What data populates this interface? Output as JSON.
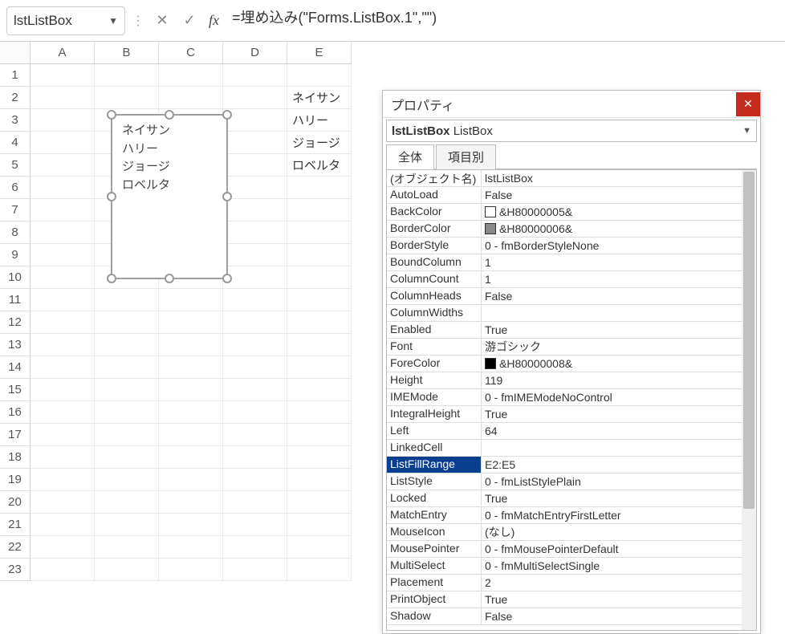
{
  "nameBox": "lstListBox",
  "formula": "=埋め込み(\"Forms.ListBox.1\",\"\")",
  "columns": [
    "A",
    "B",
    "C",
    "D",
    "E"
  ],
  "rowNumbers": [
    1,
    2,
    3,
    4,
    5,
    6,
    7,
    8,
    9,
    10,
    11,
    12,
    13,
    14,
    15,
    16,
    17,
    18,
    19,
    20,
    21,
    22,
    23
  ],
  "colE": {
    "r2": "ネイサン",
    "r3": "ハリー",
    "r4": "ジョージ",
    "r5": "ロベルタ"
  },
  "listboxItems": [
    "ネイサン",
    "ハリー",
    "ジョージ",
    "ロベルタ"
  ],
  "propTitle": "プロパティ",
  "objSelectName": "lstListBox",
  "objSelectType": "ListBox",
  "tabs": {
    "all": "全体",
    "cat": "項目別"
  },
  "props": [
    {
      "name": "(オブジェクト名)",
      "val": "lstListBox"
    },
    {
      "name": "AutoLoad",
      "val": "False"
    },
    {
      "name": "BackColor",
      "val": "&H80000005&",
      "swatch": "sw-white"
    },
    {
      "name": "BorderColor",
      "val": "&H80000006&",
      "swatch": "sw-gray"
    },
    {
      "name": "BorderStyle",
      "val": "0 - fmBorderStyleNone"
    },
    {
      "name": "BoundColumn",
      "val": "1"
    },
    {
      "name": "ColumnCount",
      "val": "1"
    },
    {
      "name": "ColumnHeads",
      "val": "False"
    },
    {
      "name": "ColumnWidths",
      "val": ""
    },
    {
      "name": "Enabled",
      "val": "True"
    },
    {
      "name": "Font",
      "val": "游ゴシック"
    },
    {
      "name": "ForeColor",
      "val": "&H80000008&",
      "swatch": "sw-black"
    },
    {
      "name": "Height",
      "val": "119"
    },
    {
      "name": "IMEMode",
      "val": "0 - fmIMEModeNoControl"
    },
    {
      "name": "IntegralHeight",
      "val": "True"
    },
    {
      "name": "Left",
      "val": "64"
    },
    {
      "name": "LinkedCell",
      "val": ""
    },
    {
      "name": "ListFillRange",
      "val": "E2:E5",
      "sel": true
    },
    {
      "name": "ListStyle",
      "val": "0 - fmListStylePlain"
    },
    {
      "name": "Locked",
      "val": "True"
    },
    {
      "name": "MatchEntry",
      "val": "0 - fmMatchEntryFirstLetter"
    },
    {
      "name": "MouseIcon",
      "val": "(なし)"
    },
    {
      "name": "MousePointer",
      "val": "0 - fmMousePointerDefault"
    },
    {
      "name": "MultiSelect",
      "val": "0 - fmMultiSelectSingle"
    },
    {
      "name": "Placement",
      "val": "2"
    },
    {
      "name": "PrintObject",
      "val": "True"
    },
    {
      "name": "Shadow",
      "val": "False"
    }
  ]
}
